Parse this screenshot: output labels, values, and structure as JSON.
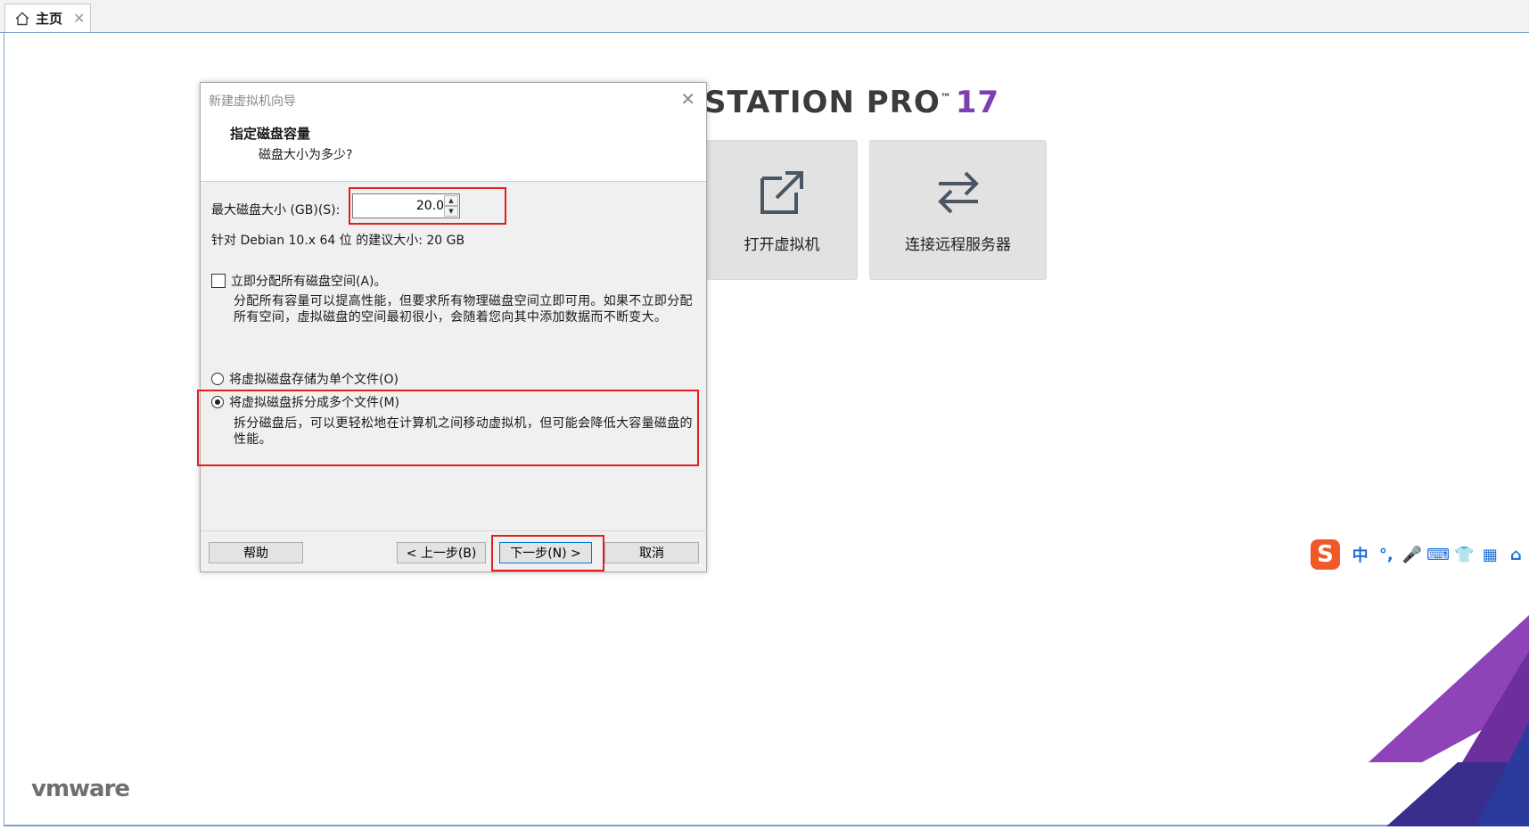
{
  "tabbar": {
    "home_tab_label": "主页",
    "close_glyph": "✕"
  },
  "home": {
    "brand_heading": "STATION PRO",
    "brand_tm": "™",
    "brand_version": "17",
    "cards": [
      {
        "label": "打开虚拟机",
        "icon": "open-external-icon"
      },
      {
        "label": "连接远程服务器",
        "icon": "swap-arrows-icon"
      }
    ],
    "vendor_logo": "vmware"
  },
  "ime": {
    "logo": "S",
    "items": [
      "中",
      "°,",
      "🎤",
      "⌨",
      "👕",
      "▦",
      "⌂"
    ]
  },
  "dialog": {
    "title": "新建虚拟机向导",
    "close_glyph": "✕",
    "heading": "指定磁盘容量",
    "subheading": "磁盘大小为多少?",
    "max_disk_label": "最大磁盘大小 (GB)(S):",
    "max_disk_value": "20.0",
    "recommended": "针对 Debian 10.x 64 位 的建议大小: 20 GB",
    "allocate_now_label": "立即分配所有磁盘空间(A)。",
    "allocate_now_checked": false,
    "allocate_desc": "分配所有容量可以提高性能，但要求所有物理磁盘空间立即可用。如果不立即分配所有空间，虚拟磁盘的空间最初很小，会随着您向其中添加数据而不断变大。",
    "single_file_label": "将虚拟磁盘存储为单个文件(O)",
    "split_files_label": "将虚拟磁盘拆分成多个文件(M)",
    "selected_option": "split",
    "split_desc": "拆分磁盘后，可以更轻松地在计算机之间移动虚拟机，但可能会降低大容量磁盘的性能。",
    "buttons": {
      "help": "帮助",
      "back": "< 上一步(B)",
      "next": "下一步(N) >",
      "cancel": "取消"
    }
  },
  "colors": {
    "annotation_red": "#e02020",
    "brand_purple": "#7b3fb0",
    "ime_blue": "#1c6fd8",
    "ime_orange": "#f05a28"
  }
}
